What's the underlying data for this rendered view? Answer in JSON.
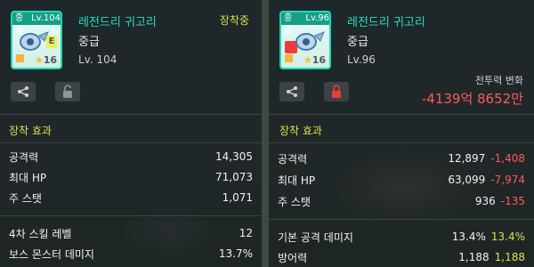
{
  "left_item": {
    "grade_tag": "중급",
    "card_level": "Lv.104",
    "badge": "E",
    "stars": "16",
    "name": "레전드리 귀고리",
    "equip_status": "장착중",
    "grade": "중급",
    "level": "Lv. 104"
  },
  "right_item": {
    "grade_tag": "중급",
    "card_level": "Lv.96",
    "stars": "16",
    "name": "레전드리 귀고리",
    "grade": "중급",
    "level": "Lv.96",
    "power_change_label": "전투력 변화",
    "power_change_value": "-4139억 8652만"
  },
  "left_effects": {
    "title": "장착 효과",
    "stats": [
      {
        "label": "공격력",
        "value": "14,305"
      },
      {
        "label": "최대 HP",
        "value": "71,073"
      },
      {
        "label": "주 스탯",
        "value": "1,071"
      },
      {
        "label": "4차 스킬 레벨",
        "value": "12"
      },
      {
        "label": "보스 몬스터 데미지",
        "value": "13.7%"
      }
    ]
  },
  "right_effects": {
    "title": "장착 효과",
    "stats": [
      {
        "label": "공격력",
        "value": "12,897",
        "diff": "-1,408"
      },
      {
        "label": "최대 HP",
        "value": "63,099",
        "diff": "-7,974"
      },
      {
        "label": "주 스탯",
        "value": "936",
        "diff": "-135"
      },
      {
        "label": "기본 공격 데미지",
        "value": "13.4%",
        "diff": "13.4%"
      },
      {
        "label": "방어력",
        "value": "1,188",
        "diff": "1,188"
      }
    ]
  },
  "icons": {
    "share": "share-icon",
    "unlock": "unlock-icon",
    "lock": "lock-icon"
  },
  "colors": {
    "item_name": "#2bdcc0",
    "highlight": "#d7e24a",
    "negative": "#ff5a5a",
    "lock_red": "#f03a3a"
  }
}
